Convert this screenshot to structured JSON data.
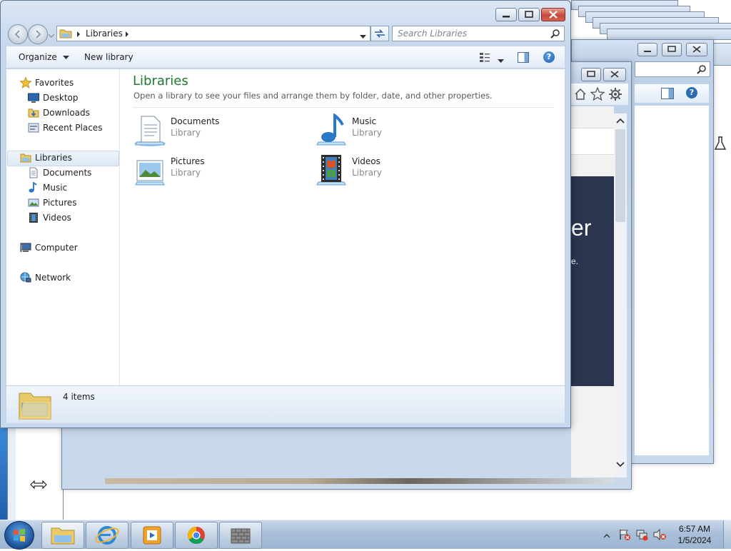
{
  "explorer": {
    "breadcrumb": "Libraries",
    "search_placeholder": "Search Libraries",
    "toolbar": {
      "organize": "Organize",
      "new_library": "New library"
    },
    "nav": {
      "favorites": "Favorites",
      "desktop": "Desktop",
      "downloads": "Downloads",
      "recent_places": "Recent Places",
      "libraries": "Libraries",
      "documents": "Documents",
      "music": "Music",
      "pictures": "Pictures",
      "videos": "Videos",
      "computer": "Computer",
      "network": "Network"
    },
    "content": {
      "heading": "Libraries",
      "subheading": "Open a library to see your files and arrange them by folder, date, and other properties.",
      "libraries": [
        {
          "name": "Documents",
          "type": "Library"
        },
        {
          "name": "Music",
          "type": "Library"
        },
        {
          "name": "Pictures",
          "type": "Library"
        },
        {
          "name": "Videos",
          "type": "Library"
        }
      ]
    },
    "status": "4 items"
  },
  "background": {
    "fragment_text_large": "er",
    "fragment_text_small": "e."
  },
  "taskbar": {
    "time": "6:57 AM",
    "date": "1/5/2024"
  },
  "colors": {
    "heading": "#1e7a2e",
    "accent": "#2a6db5",
    "dark_panel": "#2b3550"
  }
}
